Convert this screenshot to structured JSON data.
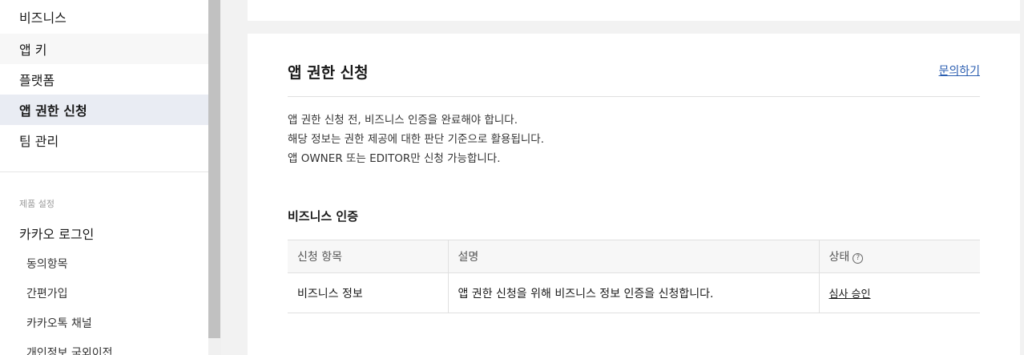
{
  "sidebar": {
    "items": [
      {
        "label": "비즈니스"
      },
      {
        "label": "앱 키"
      },
      {
        "label": "플랫폼"
      },
      {
        "label": "앱 권한 신청"
      },
      {
        "label": "팀 관리"
      }
    ],
    "section_label": "제품 설정",
    "product": "카카오 로그인",
    "sub_items": [
      {
        "label": "동의항목"
      },
      {
        "label": "간편가입"
      },
      {
        "label": "카카오톡 채널"
      },
      {
        "label": "개인정보 국외이전"
      }
    ]
  },
  "main": {
    "title": "앱 권한 신청",
    "inquiry_link": "문의하기",
    "notice": [
      "앱 권한 신청 전, 비즈니스 인증을 완료해야 합니다.",
      "해당 정보는 권한 제공에 대한 판단 기준으로 활용됩니다.",
      "앱 OWNER 또는 EDITOR만 신청 가능합니다."
    ],
    "section_title": "비즈니스 인증",
    "table": {
      "headers": [
        "신청 항목",
        "설명",
        "상태"
      ],
      "help_icon": "?",
      "rows": [
        {
          "item": "비즈니스 정보",
          "description": "앱 권한 신청을 위해 비즈니스 정보 인증을 신청합니다.",
          "status": "심사 승인"
        }
      ]
    }
  },
  "colors": {
    "active_nav_bg": "#e9ecf3",
    "link": "#2a5db0",
    "page_bg": "#f2f2f2"
  }
}
